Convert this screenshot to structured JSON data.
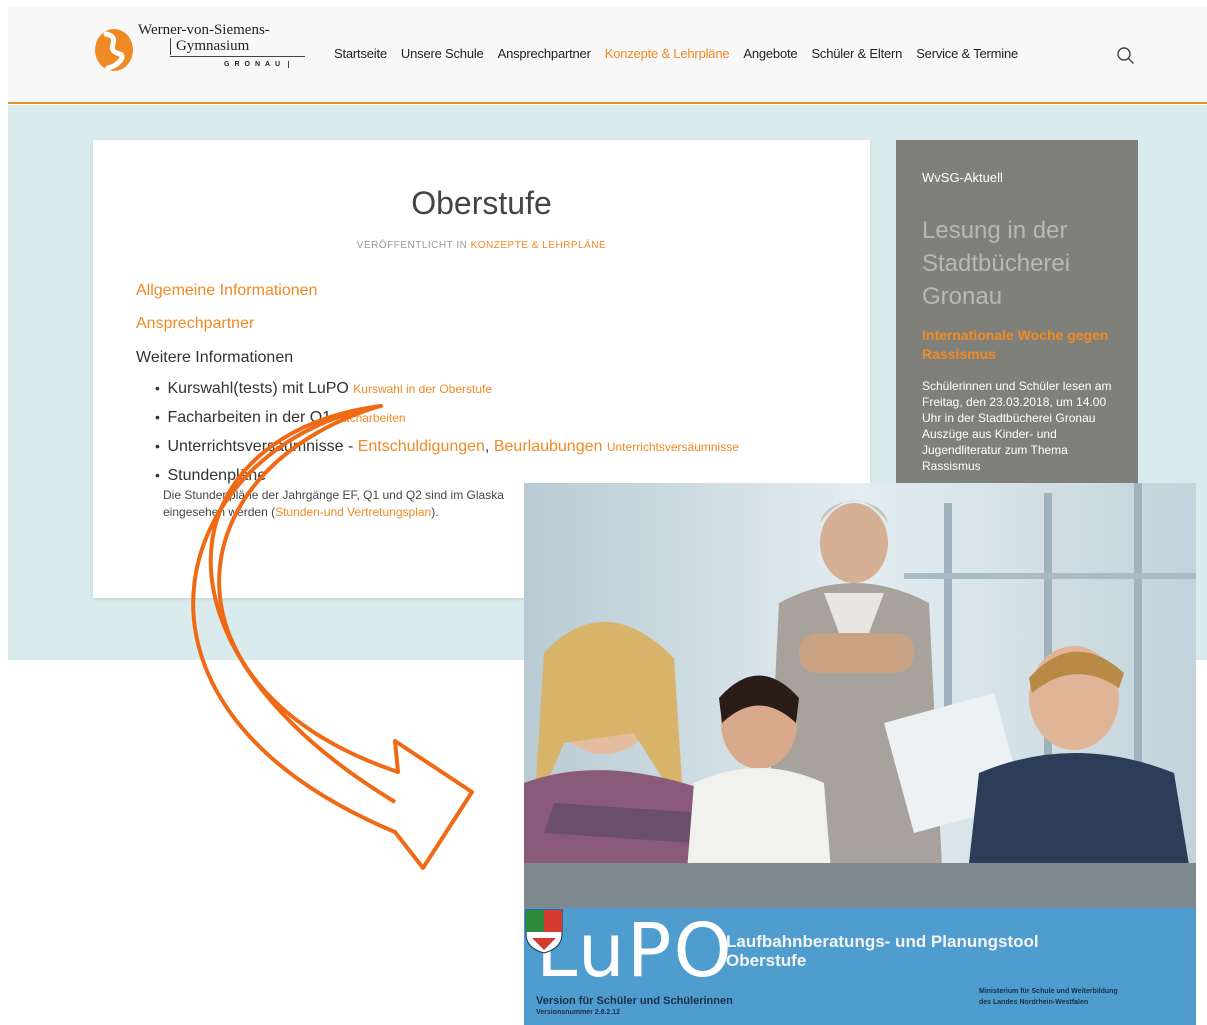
{
  "logo": {
    "line1": "Werner-von-Siemens-",
    "line2": "Gymnasium",
    "line3": "GRONAU"
  },
  "nav": {
    "items": [
      {
        "label": "Startseite"
      },
      {
        "label": "Unsere Schule"
      },
      {
        "label": "Ansprechpartner"
      },
      {
        "label": "Konzepte & Lehrpläne",
        "active": true
      },
      {
        "label": "Angebote"
      },
      {
        "label": "Schüler & Eltern"
      },
      {
        "label": "Service & Termine"
      }
    ],
    "search_icon": "search-icon"
  },
  "article": {
    "title": "Oberstufe",
    "meta_prefix": "VERÖFFENTLICHT IN",
    "meta_category": "KONZEPTE & LEHRPLÄNE",
    "links": [
      "Allgemeine Informationen",
      "Ansprechpartner"
    ],
    "further_heading": "Weitere Informationen",
    "items": [
      {
        "text": "Kurswahl(tests) mit LuPO",
        "link": "Kurswahl in der Oberstufe"
      },
      {
        "text": "Facharbeiten in der Q1",
        "link": "Facharbeiten"
      },
      {
        "text": "Unterrichtsversäumnisse - ",
        "big_link1": "Entschuldigungen",
        "separator": ", ",
        "big_link2": "Beurlaubungen",
        "link": "Unterrichtsversäumnisse"
      },
      {
        "text": "Stundenpläne",
        "desc": "Die Stundenpläne der Jahrgänge EF, Q1 und Q2 sind im Glaska",
        "desc2": "eingesehen werden (",
        "desc_link": "Stunden-und Vertretungsplan",
        "desc_end": ")."
      }
    ]
  },
  "sidebar": {
    "label": "WvSG-Aktuell",
    "title": "Lesung in der Stadtbücherei Gronau",
    "subtitle": "Internationale Woche gegen Rassismus",
    "text": "Schülerinnen und Schüler lesen am Freitag, den 23.03.2018, um 14.00 Uhr in der Stadtbücherei Gronau Auszüge aus Kinder- und Jugendliteratur zum Thema Rassismus"
  },
  "lupo": {
    "logo": "LuPO",
    "title1": "Laufbahnberatungs- und Planungstool",
    "title2": "Oberstufe",
    "version1": "Version für Schüler und Schülerinnen",
    "version2": "Versionsnummer 2.8.2.12",
    "ministry": "Ministerium für Schule und Weiterbildung des Landes Nordrhein-Westfalen"
  },
  "colors": {
    "accent": "#f08a24",
    "band": "#d9ebec",
    "sidebar": "#80807a",
    "lupo_blue": "#4f9cce"
  }
}
